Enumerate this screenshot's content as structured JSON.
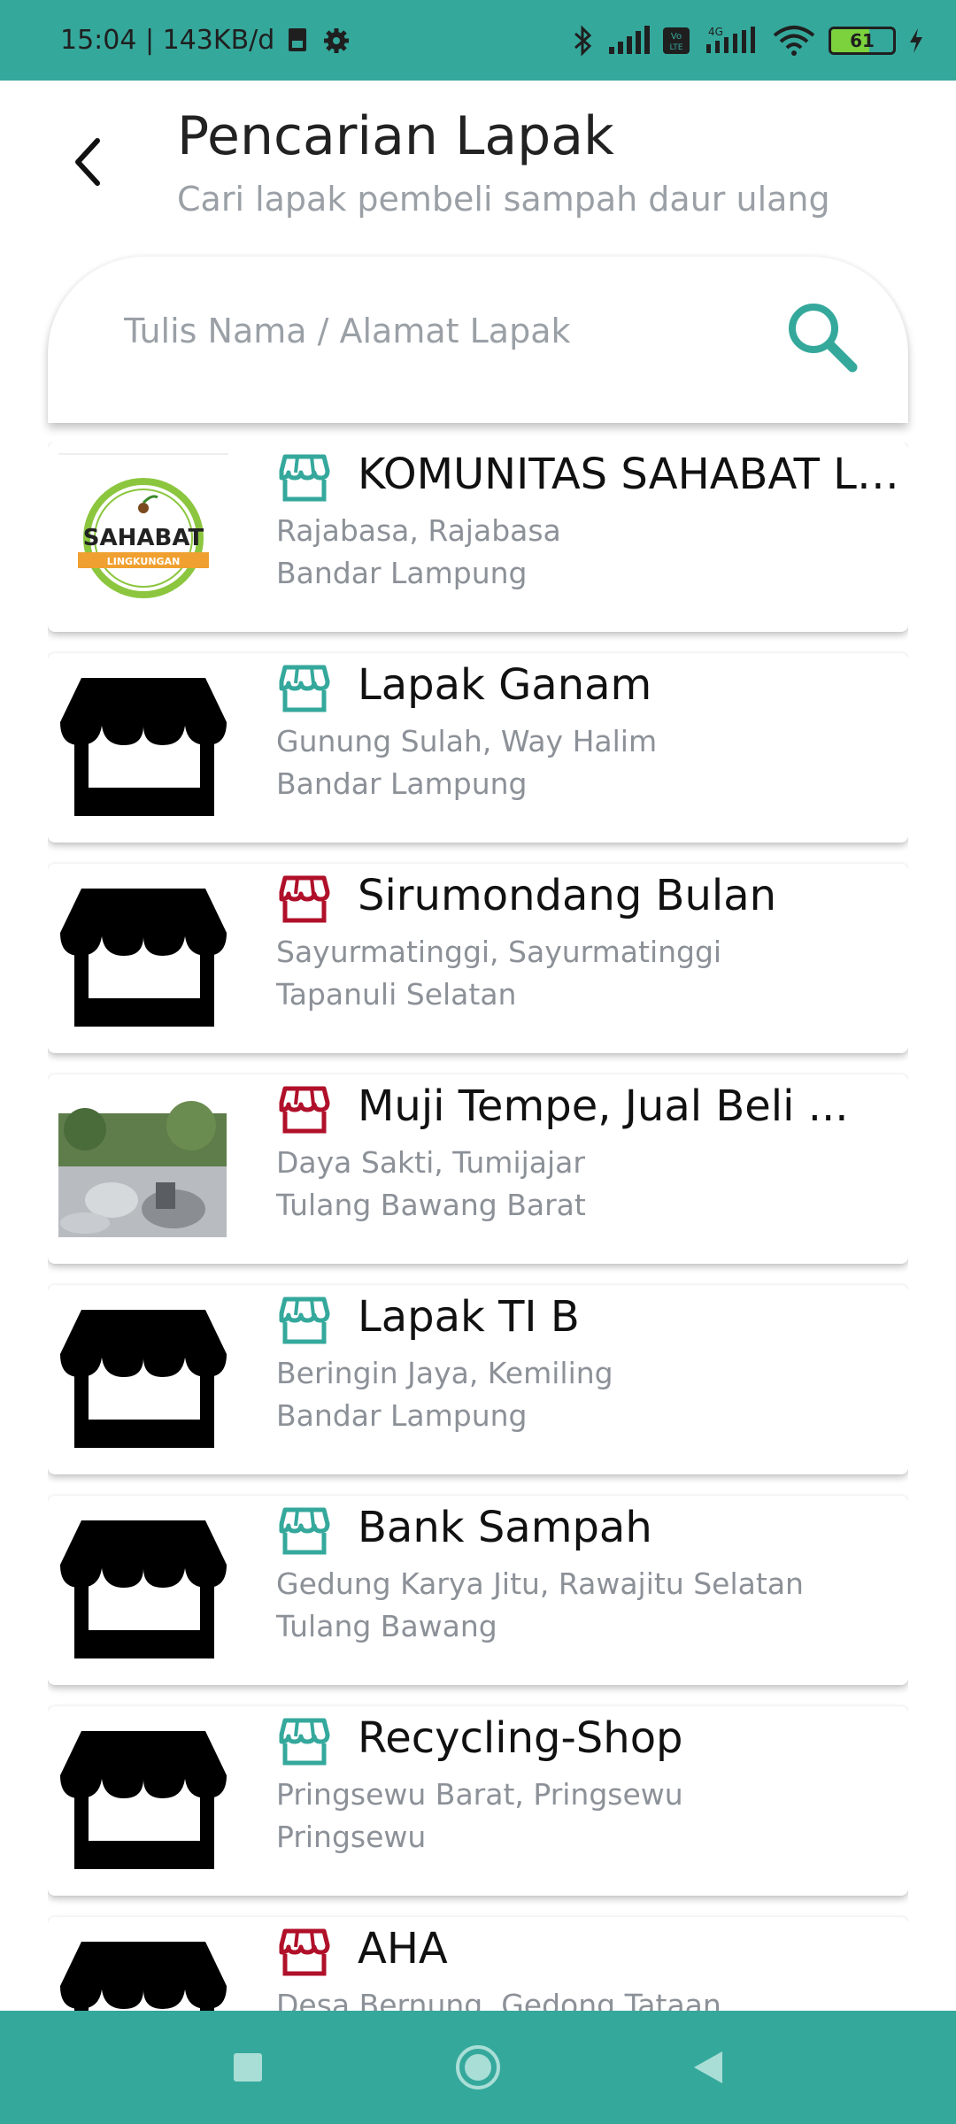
{
  "status_bar": {
    "time_info": "15:04 | 143KB/d",
    "battery_level": "61",
    "network": "4G"
  },
  "header": {
    "title": "Pencarian Lapak",
    "subtitle": "Cari lapak pembeli sampah daur ulang"
  },
  "search": {
    "placeholder": "Tulis Nama / Alamat Lapak",
    "value": ""
  },
  "colors": {
    "accent": "#35a89c",
    "store_green": "#35a89c",
    "store_red": "#b0102a"
  },
  "lapak_list": [
    {
      "name": "KOMUNITAS SAHABAT LING...",
      "address1": "Rajabasa, Rajabasa",
      "address2": "Bandar Lampung",
      "icon_color": "green",
      "thumbnail": "sahabat-logo",
      "logo_text": "SAHABAT",
      "logo_sub": "LINGKUNGAN"
    },
    {
      "name": "Lapak Ganam",
      "address1": "Gunung Sulah, Way Halim",
      "address2": "Bandar Lampung",
      "icon_color": "green",
      "thumbnail": "store-icon"
    },
    {
      "name": "Sirumondang Bulan",
      "address1": "Sayurmatinggi, Sayurmatinggi",
      "address2": "Tapanuli Selatan",
      "icon_color": "red",
      "thumbnail": "store-icon"
    },
    {
      "name": "Muji Tempe, Jual Beli ...",
      "address1": "Daya Sakti, Tumijajar",
      "address2": "Tulang Bawang Barat",
      "icon_color": "red",
      "thumbnail": "photo"
    },
    {
      "name": "Lapak TI B",
      "address1": "Beringin Jaya, Kemiling",
      "address2": "Bandar Lampung",
      "icon_color": "green",
      "thumbnail": "store-icon"
    },
    {
      "name": "Bank Sampah",
      "address1": "Gedung Karya Jitu, Rawajitu Selatan",
      "address2": "Tulang Bawang",
      "icon_color": "green",
      "thumbnail": "store-icon"
    },
    {
      "name": "Recycling-Shop",
      "address1": "Pringsewu Barat, Pringsewu",
      "address2": "Pringsewu",
      "icon_color": "green",
      "thumbnail": "store-icon"
    },
    {
      "name": "AHA",
      "address1": "Desa Bernung, Gedong Tataan",
      "address2": "",
      "icon_color": "red",
      "thumbnail": "store-icon"
    }
  ],
  "nav_bar": {
    "buttons": [
      "recents-button",
      "home-button",
      "back-button"
    ]
  }
}
